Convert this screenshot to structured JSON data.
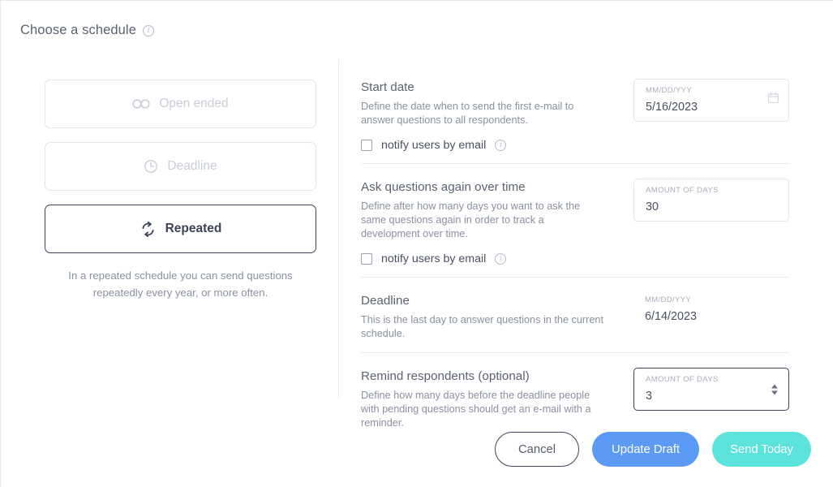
{
  "header": {
    "title": "Choose a schedule",
    "info_icon": "info-icon"
  },
  "schedule_options": [
    {
      "label": "Open ended",
      "icon": "infinity-icon",
      "state": "disabled"
    },
    {
      "label": "Deadline",
      "icon": "clock-icon",
      "state": "disabled"
    },
    {
      "label": "Repeated",
      "icon": "repeat-icon",
      "state": "selected"
    }
  ],
  "left_help_text": "In a repeated schedule you can send questions repeatedly every year, or more often.",
  "sections": [
    {
      "title": "Start date",
      "description": "Define the date when to send the first e-mail to answer questions to all respondents.",
      "input": {
        "caption": "MM/DD/YYY",
        "value": "5/16/2023",
        "type": "date",
        "icon": "calendar-icon",
        "bordered": true,
        "active": false
      },
      "checkbox": {
        "label": "notify users by email",
        "checked": false,
        "info_icon": "info-icon"
      }
    },
    {
      "title": "Ask questions again over time",
      "description": "Define after how many days you want to ask the same questions again in order to track a development over time.",
      "input": {
        "caption": "AMOUNT OF DAYS",
        "value": "30",
        "type": "number",
        "bordered": true,
        "active": false
      },
      "checkbox": {
        "label": "notify users by email",
        "checked": false,
        "info_icon": "info-icon"
      }
    },
    {
      "title": "Deadline",
      "description": "This is the last day to answer questions in the current schedule.",
      "input": {
        "caption": "MM/DD/YYY",
        "value": "6/14/2023",
        "type": "readonly-date",
        "bordered": false,
        "active": false
      },
      "checkbox": null
    },
    {
      "title": "Remind respondents (optional)",
      "description": "Define how many days before the deadline people with pending questions should get an e-mail with a reminder.",
      "input": {
        "caption": "AMOUNT OF DAYS",
        "value": "3",
        "type": "stepper",
        "bordered": true,
        "active": true
      },
      "checkbox": null
    }
  ],
  "footer": {
    "cancel_label": "Cancel",
    "update_label": "Update Draft",
    "send_label": "Send Today"
  },
  "colors": {
    "primary_blue": "#5b9bf5",
    "accent_teal": "#5be3dc",
    "selected_border": "#3d4457",
    "muted_text": "#8a919f",
    "border": "#e3e5e9"
  }
}
